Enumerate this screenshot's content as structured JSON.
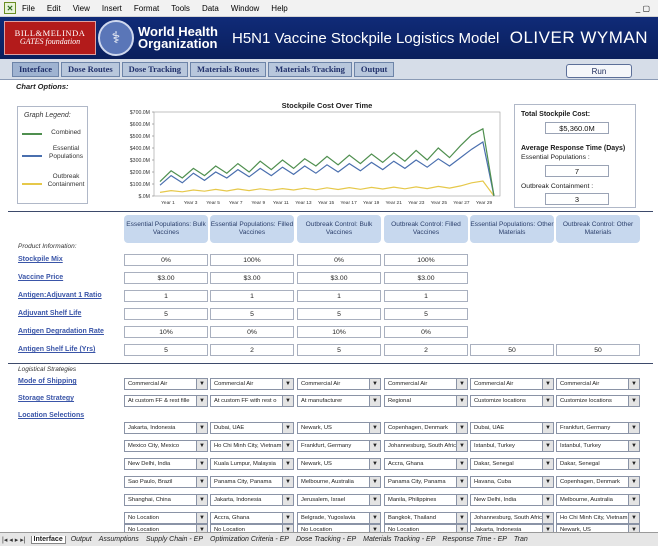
{
  "menu": [
    "File",
    "Edit",
    "View",
    "Insert",
    "Format",
    "Tools",
    "Data",
    "Window",
    "Help"
  ],
  "window_controls": "_ ▢",
  "header": {
    "gates_line1": "BILL&MELINDA",
    "gates_line2": "GATES foundation",
    "who_line1": "World Health",
    "who_line2": "Organization",
    "title": "H5N1 Vaccine Stockpile Logistics Model",
    "brand": "OLIVER WYMAN"
  },
  "nav_tabs": [
    "Interface",
    "Dose Routes",
    "Dose Tracking",
    "Materials Routes",
    "Materials Tracking",
    "Output"
  ],
  "run_label": "Run",
  "chart_options_label": "Chart Options:",
  "legend": {
    "title": "Graph Legend:",
    "items": [
      {
        "label": "Combined",
        "color": "#4f8f4f"
      },
      {
        "label": "Essential Populations",
        "color": "#4a6fae"
      },
      {
        "label": "Outbreak Containment",
        "color": "#e6c84a"
      }
    ]
  },
  "chart_data": {
    "type": "line",
    "title": "Stockpile Cost Over Time",
    "xlabel": "",
    "ylabel": "",
    "x": [
      1,
      2,
      3,
      4,
      5,
      6,
      7,
      8,
      9,
      10,
      11,
      12,
      13,
      14,
      15,
      16,
      17,
      18,
      19,
      20,
      21,
      22,
      23,
      24,
      25,
      26,
      27,
      28,
      29
    ],
    "x_tick_labels": [
      "Year 1",
      "Year 3",
      "Year 5",
      "Year 7",
      "Year 9",
      "Year 11",
      "Year 13",
      "Year 15",
      "Year 17",
      "Year 19",
      "Year 21",
      "Year 23",
      "Year 25",
      "Year 27",
      "Year 29"
    ],
    "y_tick_labels": [
      "$.0M",
      "$100.0M",
      "$200.0M",
      "$300.0M",
      "$400.0M",
      "$500.0M",
      "$600.0M",
      "$700.0M"
    ],
    "ylim": [
      0,
      700
    ],
    "series": [
      {
        "name": "Combined",
        "color": "#4f8f4f",
        "values": [
          120,
          210,
          150,
          230,
          170,
          250,
          190,
          270,
          200,
          290,
          220,
          300,
          230,
          310,
          250,
          330,
          260,
          340,
          270,
          350,
          280,
          360,
          290,
          380,
          300,
          400,
          320,
          420,
          510,
          560,
          0
        ]
      },
      {
        "name": "Essential Populations",
        "color": "#4a6fae",
        "values": [
          90,
          170,
          110,
          190,
          130,
          200,
          150,
          220,
          160,
          230,
          170,
          240,
          180,
          250,
          190,
          260,
          200,
          270,
          210,
          280,
          220,
          290,
          230,
          300,
          240,
          310,
          250,
          320,
          390,
          450,
          0
        ]
      },
      {
        "name": "Outbreak Containment",
        "color": "#e6c84a",
        "values": [
          30,
          45,
          35,
          50,
          40,
          55,
          42,
          58,
          45,
          60,
          48,
          62,
          50,
          65,
          52,
          68,
          54,
          70,
          56,
          72,
          58,
          74,
          60,
          76,
          62,
          80,
          66,
          84,
          110,
          125,
          0
        ]
      }
    ]
  },
  "summary": {
    "total_cost_label": "Total Stockpile Cost:",
    "total_cost": "$5,360.0M",
    "avg_response_label": "Average Response Time (Days)",
    "essential_label": "Essential Populations :",
    "essential_value": "7",
    "outbreak_label": "Outbreak Containment :",
    "outbreak_value": "3"
  },
  "columns": [
    "Essential Populations: Bulk Vaccines",
    "Essential Populations: Filled Vaccines",
    "Outbreak Control: Bulk Vaccines",
    "Outbreak Control: Filled Vaccines",
    "Essential Populations: Other Materials",
    "Outbreak Control: Other Materials"
  ],
  "product_header": "Product Information:",
  "product_rows": [
    {
      "label": "Stockpile Mix",
      "values": [
        "0%",
        "100%",
        "0%",
        "100%"
      ]
    },
    {
      "label": "Vaccine Price",
      "values": [
        "$3.00",
        "$3.00",
        "$3.00",
        "$3.00"
      ]
    },
    {
      "label": "Antigen:Adjuvant 1 Ratio",
      "values": [
        "1",
        "1",
        "1",
        "1"
      ]
    },
    {
      "label": "Adjuvant Shelf Life",
      "values": [
        "5",
        "5",
        "5",
        "5"
      ]
    },
    {
      "label": "Antigen Degradation Rate",
      "values": [
        "10%",
        "0%",
        "10%",
        "0%"
      ]
    },
    {
      "label": "Antigen Shelf Life (Yrs)",
      "values": [
        "5",
        "2",
        "5",
        "2",
        "50",
        "50"
      ]
    }
  ],
  "logistics_header": "Logistical Strategies",
  "logistics_labels": [
    "Mode of Shipping",
    "Storage Strategy",
    "Location Selections"
  ],
  "shipping": [
    "Commercial Air",
    "Commercial Air",
    "Commercial Air",
    "Commercial Air",
    "Commercial Air",
    "Commercial Air"
  ],
  "storage": [
    "At custom FF & rest fille",
    "At custom FF with rest o",
    "At manufacturer",
    "Regional",
    "Customize locations",
    "Customize locations"
  ],
  "locations": [
    [
      "Jakarta, Indonesia",
      "Mexico City, Mexico",
      "New Delhi, India",
      "Sao Paulo, Brazil",
      "Shanghai, China",
      "No Location",
      "No Location"
    ],
    [
      "Dubai, UAE",
      "Ho Chi Minh City, Vietnam",
      "Kuala Lumpur, Malaysia",
      "Panama City, Panama",
      "Jakarta, Indonesia",
      "Accra, Ghana",
      "No Location"
    ],
    [
      "Newark, US",
      "Frankfurt, Germany",
      "Newark, US",
      "Melbourne, Australia",
      "Jerusalem, Israel",
      "Belgrade, Yugoslavia",
      "No Location"
    ],
    [
      "Copenhagen, Denmark",
      "Johannesburg, South Africa",
      "Accra, Ghana",
      "Panama City, Panama",
      "Manila, Philippines",
      "Bangkok, Thailand",
      "No Location"
    ],
    [
      "Dubai, UAE",
      "Istanbul, Turkey",
      "Dakar, Senegal",
      "Havana, Cuba",
      "New Delhi, India",
      "Johannesburg, South Africa",
      "Jakarta, Indonesia"
    ],
    [
      "Frankfurt, Germany",
      "Istanbul, Turkey",
      "Dakar, Senegal",
      "Copenhagen, Denmark",
      "Melbourne, Australia",
      "Ho Chi Minh City, Vietnam",
      "Newark, US"
    ]
  ],
  "sheet_tabs": [
    "Interface",
    "Output",
    "Assumptions",
    "Supply Chain - EP",
    "Optimization Criteria - EP",
    "Dose Tracking - EP",
    "Materials Tracking - EP",
    "Response Time - EP",
    "Tran"
  ]
}
